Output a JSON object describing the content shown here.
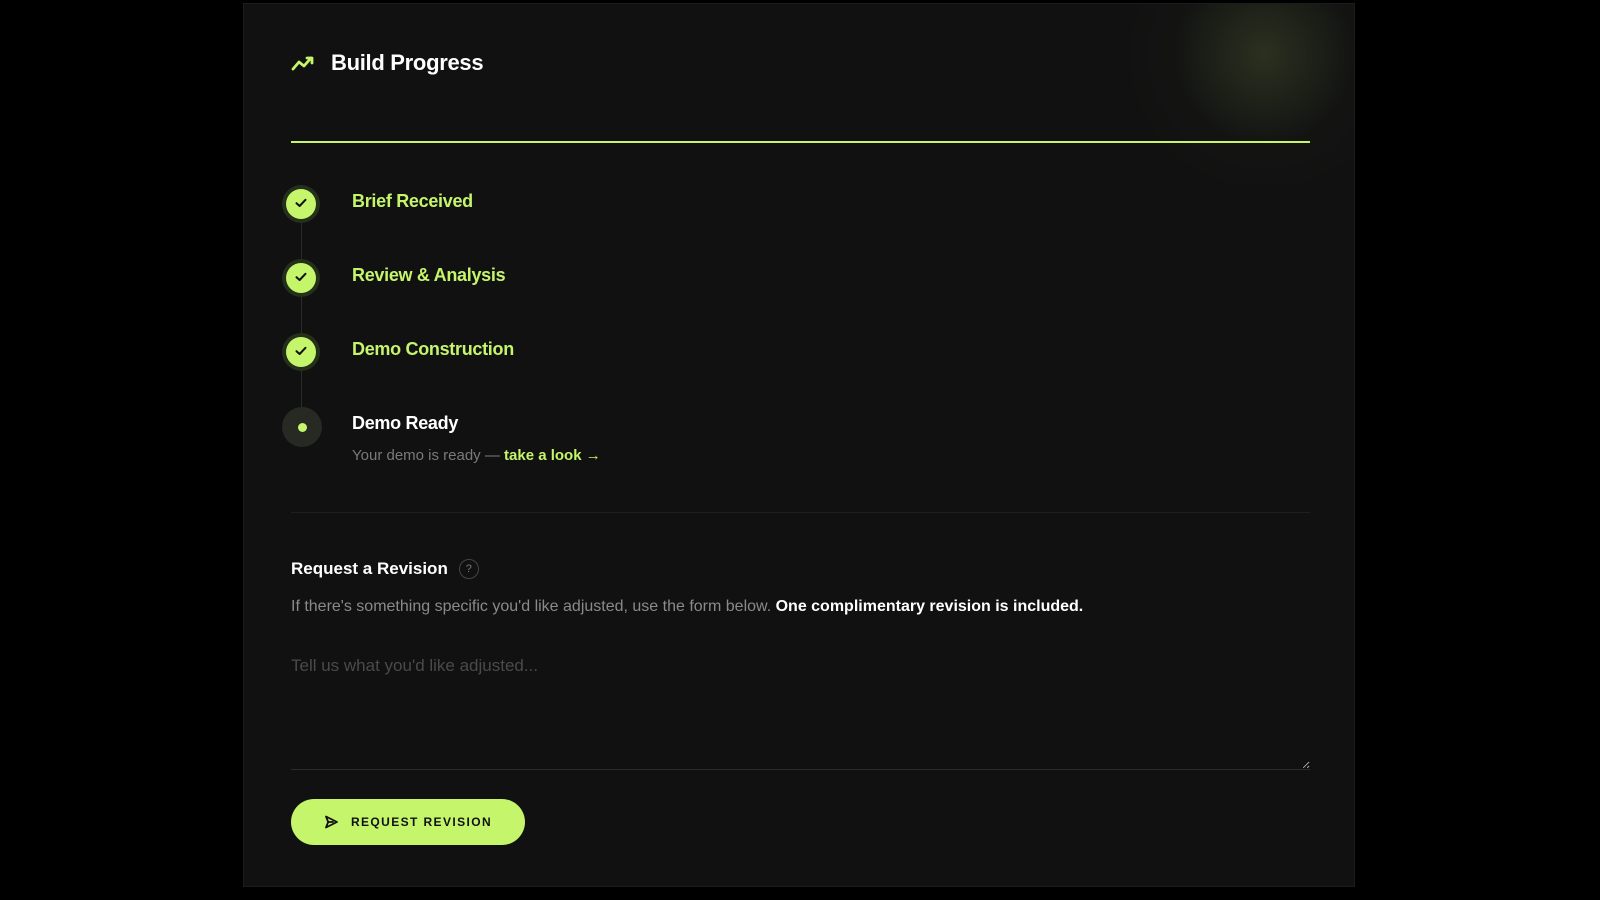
{
  "header": {
    "title": "Build Progress",
    "icon": "trend-line-icon",
    "progress_percent": 100
  },
  "timeline": {
    "steps": [
      {
        "label": "Brief Received",
        "status": "complete",
        "icon": "check-icon"
      },
      {
        "label": "Review & Analysis",
        "status": "complete",
        "icon": "check-icon"
      },
      {
        "label": "Demo Construction",
        "status": "complete",
        "icon": "check-icon"
      },
      {
        "label": "Demo Ready",
        "status": "current",
        "icon": "dot-icon"
      }
    ],
    "current_sub_text": "Your demo is ready — ",
    "current_sub_link": "take a look →"
  },
  "revision": {
    "title": "Request a Revision",
    "help_glyph": "?",
    "description": "If there's something specific you'd like adjusted, use the form below. ",
    "description_bold": "One complimentary revision is included.",
    "textarea_placeholder": "Tell us what you'd like adjusted...",
    "textarea_value": "",
    "button_label": "REQUEST REVISION",
    "button_icon": "send-icon"
  },
  "colors": {
    "accent": "#c5f56a",
    "background": "#111111",
    "page": "#000000"
  }
}
